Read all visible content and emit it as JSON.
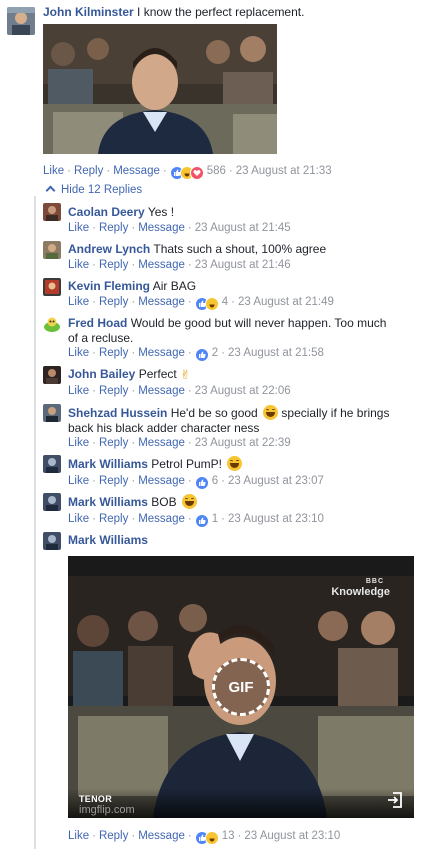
{
  "labels": {
    "like": "Like",
    "reply": "Reply",
    "message": "Message",
    "dot": "·"
  },
  "colors": {
    "name": "#365899",
    "link": "#4267b2",
    "meta": "#90949c",
    "like": "#4f86f7",
    "love": "#f25268",
    "haha": "#f7c532"
  },
  "main_comment": {
    "author": "John Kilminster",
    "text": "I know the perfect replacement.",
    "reactions": [
      "like",
      "haha",
      "love"
    ],
    "reaction_count": "586",
    "timestamp": "23 August at 21:33"
  },
  "hide_replies": "Hide 12 Replies",
  "replies": [
    {
      "author": "Caolan Deery",
      "text": "Yes !",
      "timestamp": "23 August at 21:45"
    },
    {
      "author": "Andrew Lynch",
      "text": "Thats such a shout, 100% agree",
      "timestamp": "23 August at 21:46"
    },
    {
      "author": "Kevin Fleming",
      "text": "Air BAG",
      "reactions": [
        "like",
        "haha"
      ],
      "reaction_count": "4",
      "timestamp": "23 August at 21:49"
    },
    {
      "author": "Fred Hoad",
      "text": "Would be good but will never happen. Too much of a recluse.",
      "reactions": [
        "like"
      ],
      "reaction_count": "2",
      "timestamp": "23 August at 21:58"
    },
    {
      "author": "John Bailey",
      "text": "Perfect",
      "emoji": "ok-hand-emoji",
      "timestamp": "23 August at 22:06"
    },
    {
      "author": "Shehzad Hussein",
      "text": "He'd be so good",
      "emoji": "laughing-emoji",
      "text2": "specially if he brings back his black adder character ness",
      "timestamp": "23 August at 22:39"
    },
    {
      "author": "Mark Williams",
      "text": "Petrol PumP!",
      "emoji": "laughing-emoji",
      "reactions": [
        "like"
      ],
      "reaction_count": "6",
      "timestamp": "23 August at 23:07"
    },
    {
      "author": "Mark Williams",
      "text": "BOB",
      "emoji": "laughing-emoji",
      "reactions": [
        "like"
      ],
      "reaction_count": "1",
      "timestamp": "23 August at 23:10"
    },
    {
      "author": "Mark Williams",
      "gif": {
        "badge": "GIF",
        "provider": "TENOR",
        "watermark": "imgflip.com",
        "channel_top": "BBC",
        "channel": "Knowledge"
      },
      "reactions": [
        "like",
        "haha"
      ],
      "reaction_count": "13",
      "timestamp": "23 August at 23:10"
    }
  ]
}
